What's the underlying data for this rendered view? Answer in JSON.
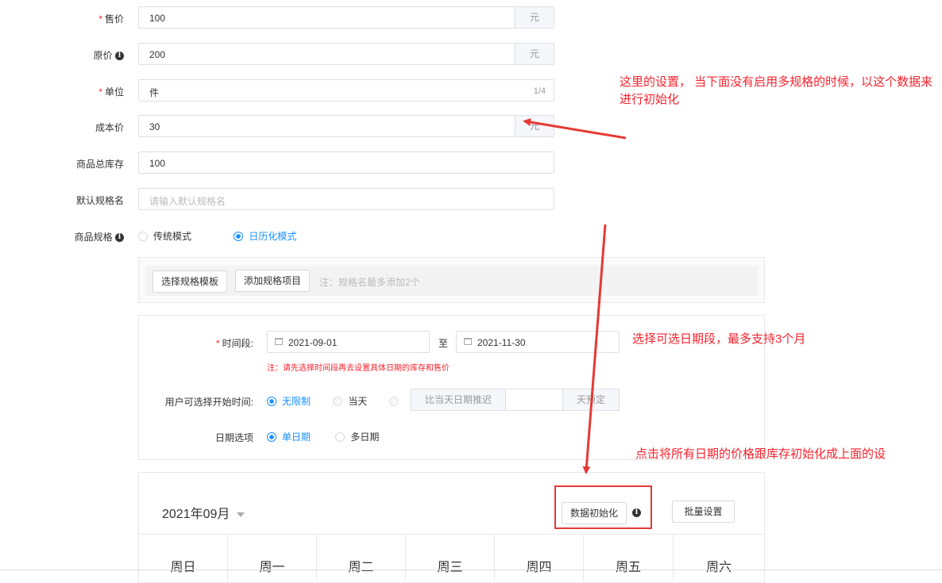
{
  "form": {
    "price": {
      "label": "售价",
      "value": "100",
      "suffix": "元"
    },
    "original_price": {
      "label": "原价",
      "value": "200",
      "suffix": "元"
    },
    "unit": {
      "label": "单位",
      "value": "件",
      "count": "1/4"
    },
    "cost_price": {
      "label": "成本价",
      "value": "30",
      "suffix": "元"
    },
    "total_stock": {
      "label": "商品总库存",
      "value": "100"
    },
    "default_spec_name": {
      "label": "默认规格名",
      "placeholder": "请输入默认规格名"
    },
    "spec": {
      "label": "商品规格",
      "options": [
        "传统模式",
        "日历化模式"
      ],
      "selected": "日历化模式"
    }
  },
  "spec_panel": {
    "select_template_button": "选择规格模板",
    "add_spec_item_button": "添加规格项目",
    "note": "注：规格名最多添加2个"
  },
  "time_panel": {
    "period_label": "时间段:",
    "start_date": "2021-09-01",
    "to_text": "至",
    "end_date": "2021-11-30",
    "warning": "注：请先选择时间段再去设置具体日期的库存和售价",
    "start_time_label": "用户可选择开始时间:",
    "start_options": [
      "无限制",
      "当天",
      ""
    ],
    "start_selected": "无限制",
    "delay_prefix": "比当天日期推迟",
    "delay_suffix": "天预定",
    "date_option_label": "日期选项",
    "date_options": [
      "单日期",
      "多日期"
    ],
    "date_selected": "单日期"
  },
  "calendar": {
    "month_title": "2021年09月",
    "init_button": "数据初始化",
    "batch_button": "批量设置",
    "weekdays": [
      "周日",
      "周一",
      "周二",
      "周三",
      "周四",
      "周五",
      "周六"
    ]
  },
  "annotations": {
    "note1": "这里的设置， 当下面没有启用多规格的时候，以这个数据来进行初始化",
    "note2": "选择可选日期段，最多支持3个月",
    "note3": "点击将所有日期的价格跟库存初始化成上面的设"
  },
  "colors": {
    "accent": "#1890ff",
    "annotation": "#f5222d"
  }
}
